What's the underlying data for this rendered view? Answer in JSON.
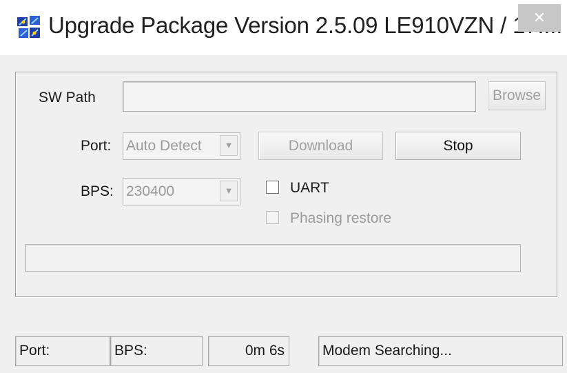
{
  "window": {
    "title": "Upgrade Package Version 2.5.09  LE910VZN / 17....",
    "close_glyph": "✕"
  },
  "form": {
    "sw_path_label": "SW Path",
    "sw_path_value": "",
    "browse_label": "Browse",
    "port_label": "Port:",
    "port_selected": "Auto Detect",
    "download_label": "Download",
    "stop_label": "Stop",
    "bps_label": "BPS:",
    "bps_selected": "230400",
    "uart_label": "UART",
    "uart_checked": false,
    "phasing_restore_label": "Phasing restore",
    "phasing_restore_checked": false
  },
  "progress": {
    "value_percent": 0
  },
  "status_bar": {
    "port": "Port:",
    "bps": "BPS:",
    "elapsed": "0m  6s",
    "message": "Modem Searching..."
  },
  "icons": {
    "app": "app-icon",
    "dropdown": "chevron-down-icon"
  },
  "colors": {
    "window_bg": "#f0f0f0",
    "titlebar_bg": "#ffffff",
    "close_bg": "#c7c7c7",
    "disabled_text": "#9b9b9b"
  }
}
